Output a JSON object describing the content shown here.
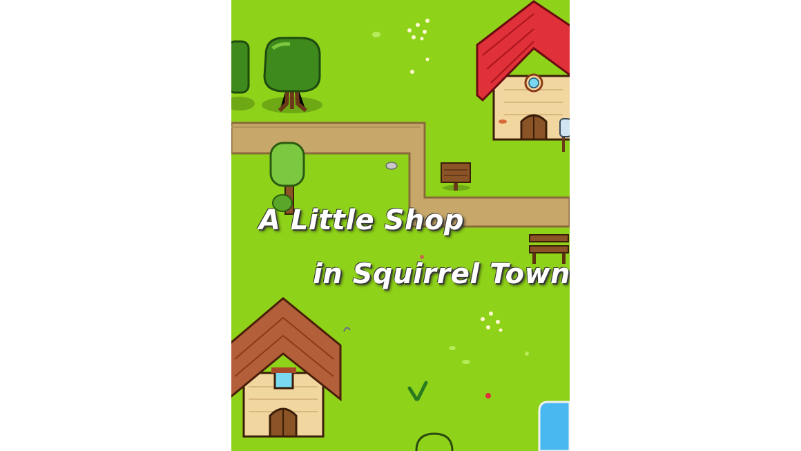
{
  "game": {
    "title_line_1": "A Little Shop",
    "title_line_2": "in Squirrel Town"
  },
  "colors": {
    "grass": "#8fd21a",
    "path": "#c7a86a",
    "roof_red": "#e0303a",
    "roof_brown": "#b3603a",
    "wall": "#f2d6a0",
    "water": "#4ab8f0"
  },
  "icons": [
    "tree-icon",
    "house-icon",
    "signpost-icon",
    "bench-icon",
    "mailbox-icon",
    "rock-icon",
    "flower-icon",
    "mushroom-icon",
    "pond-icon"
  ]
}
